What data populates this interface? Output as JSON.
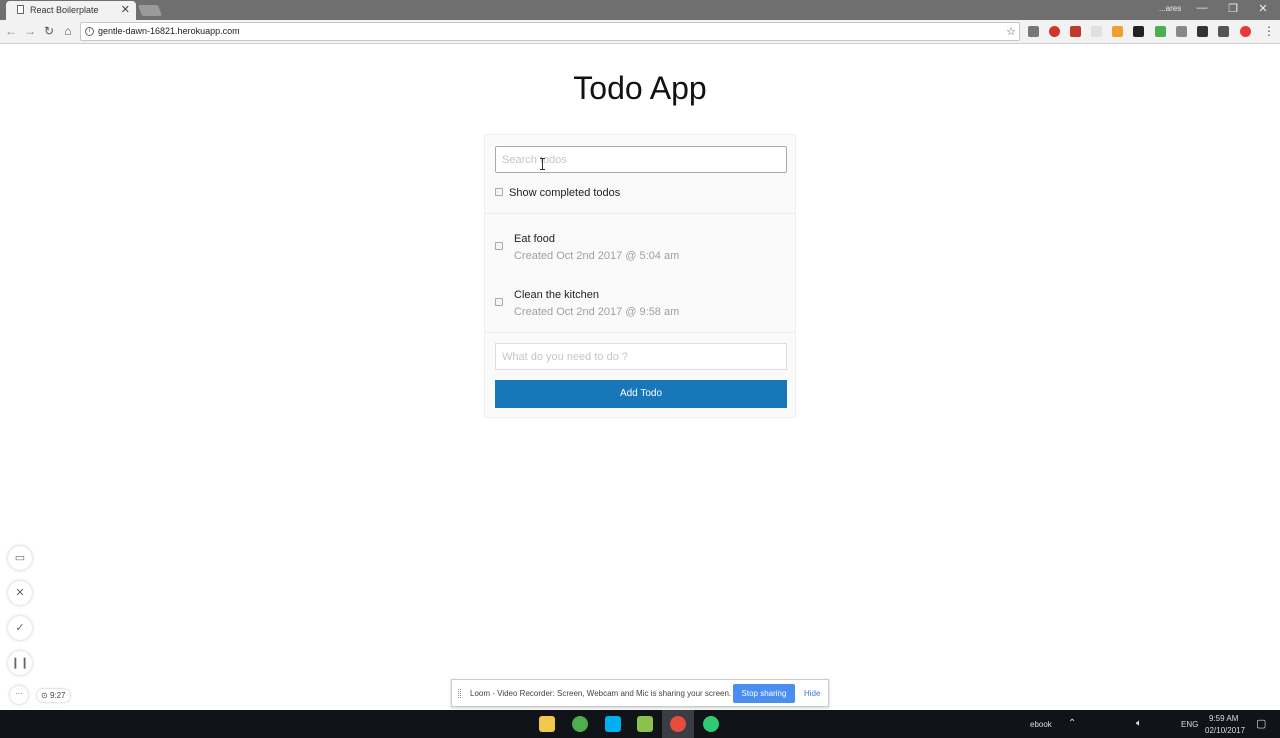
{
  "browser": {
    "tab_title": "React Boilerplate",
    "url": "gentle-dawn-16821.herokuapp.com",
    "user_label": "...ares",
    "window_controls": [
      "—",
      "❐",
      "✕"
    ]
  },
  "app": {
    "title": "Todo App",
    "search": {
      "placeholder": "Search todos",
      "value": ""
    },
    "show_completed_label": "Show completed todos",
    "todos": [
      {
        "text": "Eat food",
        "created": "Created Oct 2nd 2017 @ 5:04 am",
        "completed": false
      },
      {
        "text": "Clean the kitchen",
        "created": "Created Oct 2nd 2017 @ 9:58 am",
        "completed": false
      }
    ],
    "new_todo": {
      "placeholder": "What do you need to do ?",
      "value": ""
    },
    "add_button_label": "Add Todo",
    "accent_color": "#1877b9"
  },
  "loom": {
    "timer": "9:27",
    "share_message": "Loom - Video Recorder: Screen, Webcam and Mic is sharing your screen.",
    "stop_label": "Stop sharing",
    "hide_label": "Hide",
    "more_label": "···"
  },
  "taskbar": {
    "tray_label": "ebook",
    "language": "ENG",
    "time": "9:59 AM",
    "date": "02/10/2017"
  }
}
